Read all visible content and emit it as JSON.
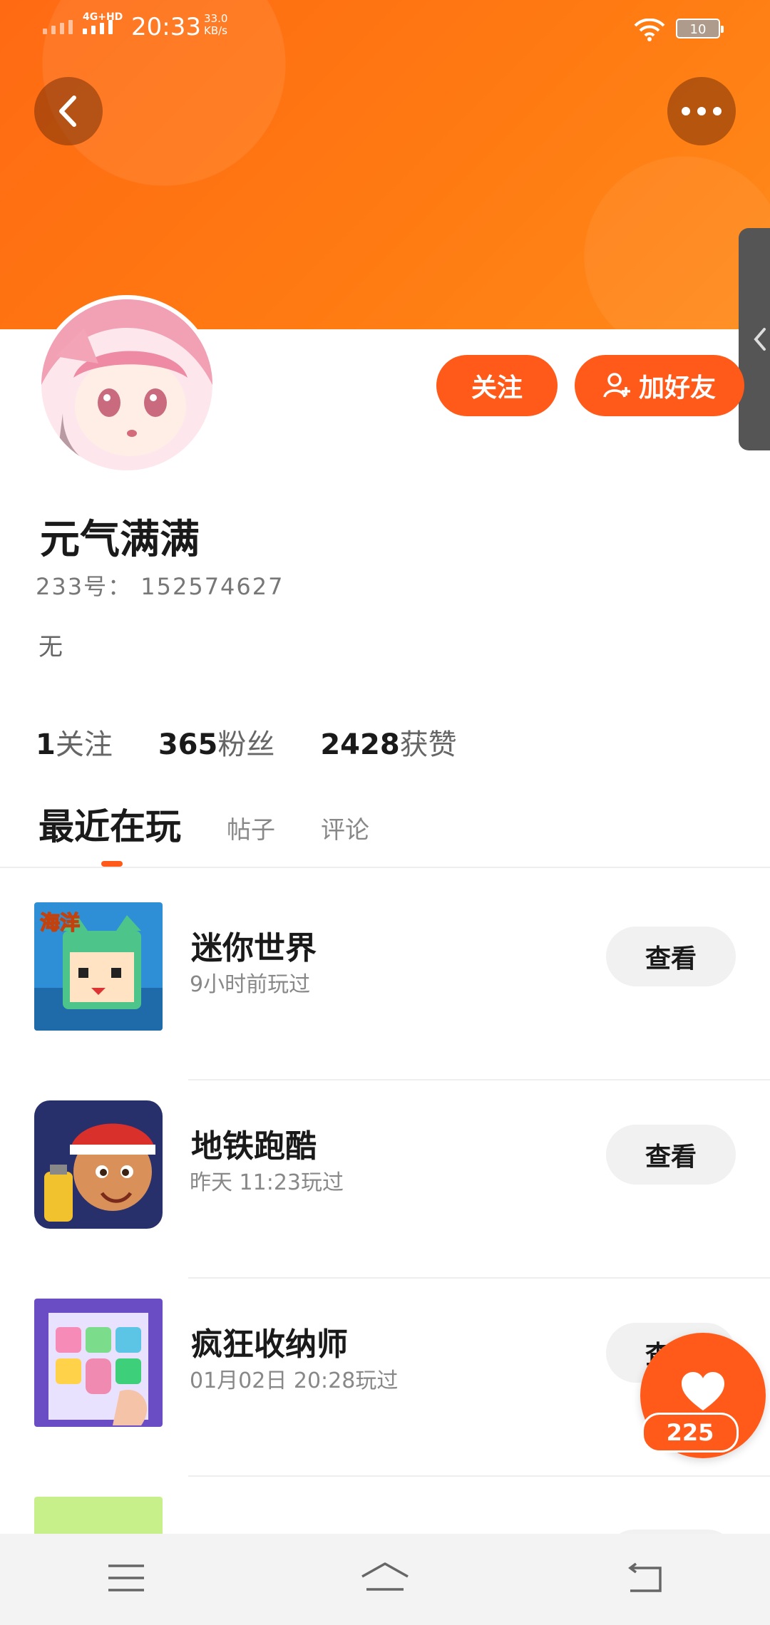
{
  "status_bar": {
    "network": "4G+HD",
    "time": "20:33",
    "speed_value": "33.0",
    "speed_unit": "KB/s",
    "battery": "10"
  },
  "profile": {
    "username": "元气满满",
    "user_id": "233号： 152574627",
    "bio": "无",
    "follow_label": "关注",
    "add_friend_label": "加好友"
  },
  "stats": [
    {
      "num": "1",
      "label": "关注"
    },
    {
      "num": "365",
      "label": "粉丝"
    },
    {
      "num": "2428",
      "label": "获赞"
    }
  ],
  "tabs": [
    "最近在玩",
    "帖子",
    "评论"
  ],
  "games": [
    {
      "name": "迷你世界",
      "time": "9小时前玩过",
      "action": "查看",
      "icon": "mini-world-icon",
      "icon_label": "海洋"
    },
    {
      "name": "地铁跑酷",
      "time": "昨天 11:23玩过",
      "action": "查看",
      "icon": "subway-surfers-icon"
    },
    {
      "name": "疯狂收纳师",
      "time": "01月02日 20:28玩过",
      "action": "查看",
      "icon": "storage-master-icon"
    }
  ],
  "like": {
    "count": "225"
  },
  "colors": {
    "accent": "#ff5a1a",
    "header": "#ff7a12"
  }
}
